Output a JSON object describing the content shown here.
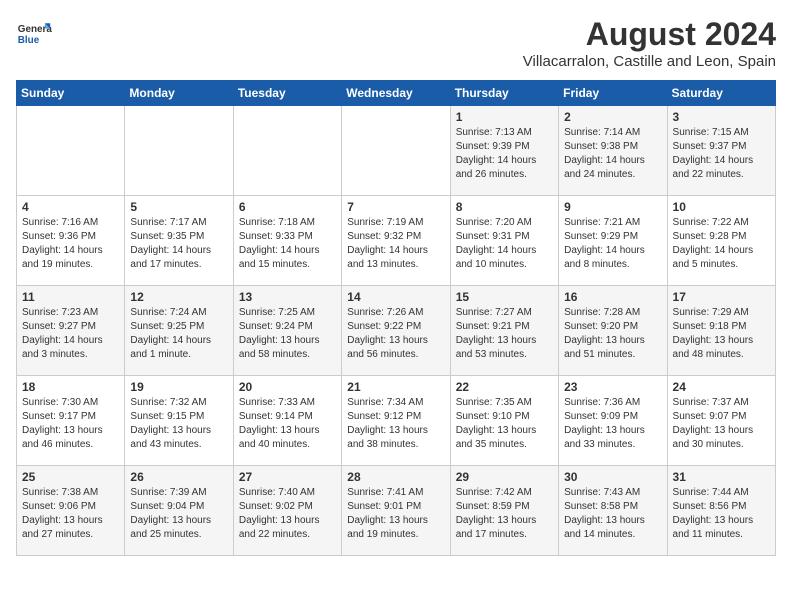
{
  "header": {
    "logo_general": "General",
    "logo_blue": "Blue",
    "month_year": "August 2024",
    "location": "Villacarralon, Castille and Leon, Spain"
  },
  "days_of_week": [
    "Sunday",
    "Monday",
    "Tuesday",
    "Wednesday",
    "Thursday",
    "Friday",
    "Saturday"
  ],
  "weeks": [
    [
      {
        "day": "",
        "detail": ""
      },
      {
        "day": "",
        "detail": ""
      },
      {
        "day": "",
        "detail": ""
      },
      {
        "day": "",
        "detail": ""
      },
      {
        "day": "1",
        "detail": "Sunrise: 7:13 AM\nSunset: 9:39 PM\nDaylight: 14 hours\nand 26 minutes."
      },
      {
        "day": "2",
        "detail": "Sunrise: 7:14 AM\nSunset: 9:38 PM\nDaylight: 14 hours\nand 24 minutes."
      },
      {
        "day": "3",
        "detail": "Sunrise: 7:15 AM\nSunset: 9:37 PM\nDaylight: 14 hours\nand 22 minutes."
      }
    ],
    [
      {
        "day": "4",
        "detail": "Sunrise: 7:16 AM\nSunset: 9:36 PM\nDaylight: 14 hours\nand 19 minutes."
      },
      {
        "day": "5",
        "detail": "Sunrise: 7:17 AM\nSunset: 9:35 PM\nDaylight: 14 hours\nand 17 minutes."
      },
      {
        "day": "6",
        "detail": "Sunrise: 7:18 AM\nSunset: 9:33 PM\nDaylight: 14 hours\nand 15 minutes."
      },
      {
        "day": "7",
        "detail": "Sunrise: 7:19 AM\nSunset: 9:32 PM\nDaylight: 14 hours\nand 13 minutes."
      },
      {
        "day": "8",
        "detail": "Sunrise: 7:20 AM\nSunset: 9:31 PM\nDaylight: 14 hours\nand 10 minutes."
      },
      {
        "day": "9",
        "detail": "Sunrise: 7:21 AM\nSunset: 9:29 PM\nDaylight: 14 hours\nand 8 minutes."
      },
      {
        "day": "10",
        "detail": "Sunrise: 7:22 AM\nSunset: 9:28 PM\nDaylight: 14 hours\nand 5 minutes."
      }
    ],
    [
      {
        "day": "11",
        "detail": "Sunrise: 7:23 AM\nSunset: 9:27 PM\nDaylight: 14 hours\nand 3 minutes."
      },
      {
        "day": "12",
        "detail": "Sunrise: 7:24 AM\nSunset: 9:25 PM\nDaylight: 14 hours\nand 1 minute."
      },
      {
        "day": "13",
        "detail": "Sunrise: 7:25 AM\nSunset: 9:24 PM\nDaylight: 13 hours\nand 58 minutes."
      },
      {
        "day": "14",
        "detail": "Sunrise: 7:26 AM\nSunset: 9:22 PM\nDaylight: 13 hours\nand 56 minutes."
      },
      {
        "day": "15",
        "detail": "Sunrise: 7:27 AM\nSunset: 9:21 PM\nDaylight: 13 hours\nand 53 minutes."
      },
      {
        "day": "16",
        "detail": "Sunrise: 7:28 AM\nSunset: 9:20 PM\nDaylight: 13 hours\nand 51 minutes."
      },
      {
        "day": "17",
        "detail": "Sunrise: 7:29 AM\nSunset: 9:18 PM\nDaylight: 13 hours\nand 48 minutes."
      }
    ],
    [
      {
        "day": "18",
        "detail": "Sunrise: 7:30 AM\nSunset: 9:17 PM\nDaylight: 13 hours\nand 46 minutes."
      },
      {
        "day": "19",
        "detail": "Sunrise: 7:32 AM\nSunset: 9:15 PM\nDaylight: 13 hours\nand 43 minutes."
      },
      {
        "day": "20",
        "detail": "Sunrise: 7:33 AM\nSunset: 9:14 PM\nDaylight: 13 hours\nand 40 minutes."
      },
      {
        "day": "21",
        "detail": "Sunrise: 7:34 AM\nSunset: 9:12 PM\nDaylight: 13 hours\nand 38 minutes."
      },
      {
        "day": "22",
        "detail": "Sunrise: 7:35 AM\nSunset: 9:10 PM\nDaylight: 13 hours\nand 35 minutes."
      },
      {
        "day": "23",
        "detail": "Sunrise: 7:36 AM\nSunset: 9:09 PM\nDaylight: 13 hours\nand 33 minutes."
      },
      {
        "day": "24",
        "detail": "Sunrise: 7:37 AM\nSunset: 9:07 PM\nDaylight: 13 hours\nand 30 minutes."
      }
    ],
    [
      {
        "day": "25",
        "detail": "Sunrise: 7:38 AM\nSunset: 9:06 PM\nDaylight: 13 hours\nand 27 minutes."
      },
      {
        "day": "26",
        "detail": "Sunrise: 7:39 AM\nSunset: 9:04 PM\nDaylight: 13 hours\nand 25 minutes."
      },
      {
        "day": "27",
        "detail": "Sunrise: 7:40 AM\nSunset: 9:02 PM\nDaylight: 13 hours\nand 22 minutes."
      },
      {
        "day": "28",
        "detail": "Sunrise: 7:41 AM\nSunset: 9:01 PM\nDaylight: 13 hours\nand 19 minutes."
      },
      {
        "day": "29",
        "detail": "Sunrise: 7:42 AM\nSunset: 8:59 PM\nDaylight: 13 hours\nand 17 minutes."
      },
      {
        "day": "30",
        "detail": "Sunrise: 7:43 AM\nSunset: 8:58 PM\nDaylight: 13 hours\nand 14 minutes."
      },
      {
        "day": "31",
        "detail": "Sunrise: 7:44 AM\nSunset: 8:56 PM\nDaylight: 13 hours\nand 11 minutes."
      }
    ]
  ]
}
